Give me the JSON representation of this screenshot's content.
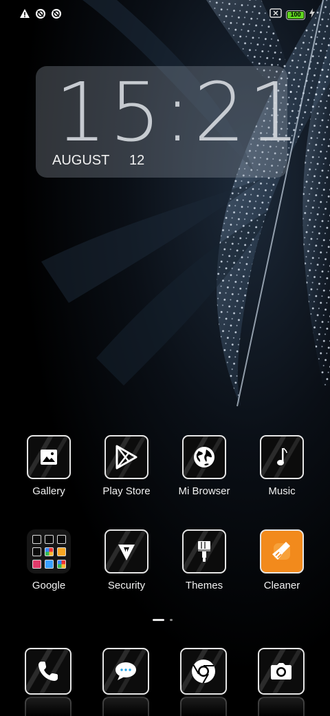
{
  "statusbar": {
    "left_icons": [
      "warning-icon",
      "sync-icon",
      "sync-icon"
    ],
    "battery_level": "100",
    "right_icons": [
      "sim-no-signal-icon",
      "battery-icon",
      "charging-icon"
    ]
  },
  "clock": {
    "time": "15:21",
    "month": "AUGUST",
    "day": "12"
  },
  "apps": [
    {
      "label": "Gallery",
      "icon": "image-icon"
    },
    {
      "label": "Play Store",
      "icon": "play-store-icon"
    },
    {
      "label": "Mi Browser",
      "icon": "globe-icon"
    },
    {
      "label": "Music",
      "icon": "music-note-icon"
    },
    {
      "label": "Google",
      "icon": "folder-icon"
    },
    {
      "label": "Security",
      "icon": "security-shield-icon"
    },
    {
      "label": "Themes",
      "icon": "paintbrush-icon"
    },
    {
      "label": "Cleaner",
      "icon": "broom-icon"
    }
  ],
  "pager": {
    "pages": 2,
    "active": 1
  },
  "dock": [
    {
      "name": "phone",
      "icon": "phone-icon"
    },
    {
      "name": "messages",
      "icon": "message-icon"
    },
    {
      "name": "chrome",
      "icon": "chrome-icon"
    },
    {
      "name": "camera",
      "icon": "camera-icon"
    }
  ],
  "colors": {
    "battery": "#5ed21f",
    "cleaner_accent": "#f28a1c"
  }
}
